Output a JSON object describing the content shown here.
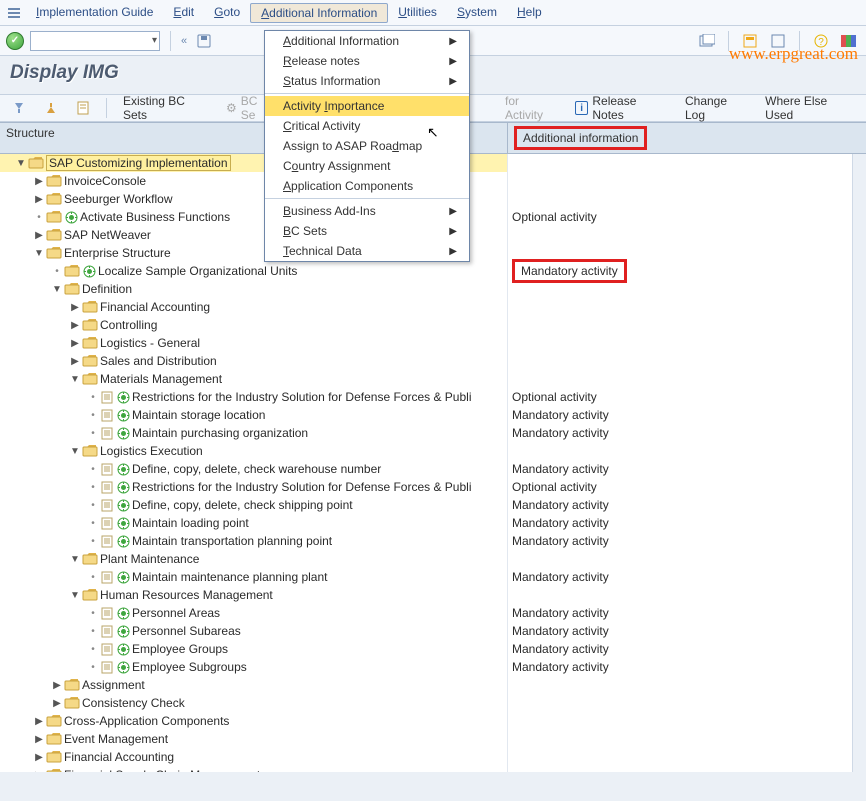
{
  "menubar": {
    "items": [
      {
        "label": "Implementation Guide",
        "u": "I"
      },
      {
        "label": "Edit",
        "u": "E"
      },
      {
        "label": "Goto",
        "u": "G"
      },
      {
        "label": "Additional Information",
        "u": "A",
        "selected": true
      },
      {
        "label": "Utilities",
        "u": "U"
      },
      {
        "label": "System",
        "u": "S"
      },
      {
        "label": "Help",
        "u": "H"
      }
    ]
  },
  "watermark": "www.erpgreat.com",
  "title": "Display IMG",
  "toolbar2": {
    "existing": "Existing BC Sets",
    "bcse": "BC Se",
    "foract": "for Activity",
    "release_notes": "Release Notes",
    "change_log": "Change Log",
    "where_else": "Where Else Used"
  },
  "header": {
    "col_struct": "Structure",
    "col_info": "Additional information"
  },
  "ctxmenu": {
    "items": [
      {
        "label": "Additional Information",
        "u": "A",
        "sub": true
      },
      {
        "label": "Release notes",
        "u": "R",
        "sub": true
      },
      {
        "label": "Status Information",
        "u": "S",
        "sub": true
      },
      {
        "sep": true
      },
      {
        "label": "Activity Importance",
        "u": "I",
        "hover": true
      },
      {
        "label": "Critical Activity",
        "u": "C"
      },
      {
        "label": "Assign to ASAP Roadmap",
        "u": "d"
      },
      {
        "label": "Country Assignment",
        "u": "o"
      },
      {
        "label": "Application Components",
        "u": "A"
      },
      {
        "sep": true
      },
      {
        "label": "Business Add-Ins",
        "u": "B",
        "sub": true
      },
      {
        "label": "BC Sets",
        "u": "B",
        "sub": true
      },
      {
        "label": "Technical Data",
        "u": "T",
        "sub": true
      }
    ]
  },
  "tree": [
    {
      "d": 0,
      "exp": "open",
      "folder": true,
      "text": "SAP Customizing Implementation",
      "hl": true,
      "sel": true,
      "info": ""
    },
    {
      "d": 1,
      "exp": "closed",
      "folder": true,
      "text": "InvoiceConsole",
      "info": ""
    },
    {
      "d": 1,
      "exp": "closed",
      "folder": true,
      "text": "Seeburger Workflow",
      "info": ""
    },
    {
      "d": 1,
      "exp": "leaf",
      "folder": true,
      "exec": true,
      "text": "Activate Business Functions",
      "info": "Optional activity"
    },
    {
      "d": 1,
      "exp": "closed",
      "folder": true,
      "text": "SAP NetWeaver",
      "info": ""
    },
    {
      "d": 1,
      "exp": "open",
      "folder": true,
      "text": "Enterprise Structure",
      "info": ""
    },
    {
      "d": 2,
      "exp": "leaf",
      "folder": true,
      "exec": true,
      "text": "Localize Sample Organizational Units",
      "info": "Mandatory activity",
      "info_red": true
    },
    {
      "d": 2,
      "exp": "open",
      "folder": true,
      "text": "Definition",
      "info": ""
    },
    {
      "d": 3,
      "exp": "closed",
      "folder": true,
      "text": "Financial Accounting",
      "info": ""
    },
    {
      "d": 3,
      "exp": "closed",
      "folder": true,
      "text": "Controlling",
      "info": ""
    },
    {
      "d": 3,
      "exp": "closed",
      "folder": true,
      "text": "Logistics - General",
      "info": ""
    },
    {
      "d": 3,
      "exp": "closed",
      "folder": true,
      "text": "Sales and Distribution",
      "info": ""
    },
    {
      "d": 3,
      "exp": "open",
      "folder": true,
      "text": "Materials Management",
      "info": ""
    },
    {
      "d": 4,
      "exp": "leaf",
      "note": true,
      "exec": true,
      "text": "Restrictions for the Industry Solution for Defense Forces & Publi",
      "info": "Optional activity"
    },
    {
      "d": 4,
      "exp": "leaf",
      "note": true,
      "exec": true,
      "text": "Maintain storage location",
      "info": "Mandatory activity"
    },
    {
      "d": 4,
      "exp": "leaf",
      "note": true,
      "exec": true,
      "text": "Maintain purchasing organization",
      "info": "Mandatory activity"
    },
    {
      "d": 3,
      "exp": "open",
      "folder": true,
      "text": "Logistics Execution",
      "info": ""
    },
    {
      "d": 4,
      "exp": "leaf",
      "note": true,
      "exec": true,
      "text": "Define, copy, delete, check warehouse number",
      "info": "Mandatory activity"
    },
    {
      "d": 4,
      "exp": "leaf",
      "note": true,
      "exec": true,
      "text": "Restrictions for the Industry Solution for Defense Forces & Publi",
      "info": "Optional activity"
    },
    {
      "d": 4,
      "exp": "leaf",
      "note": true,
      "exec": true,
      "text": "Define, copy, delete, check shipping point",
      "info": "Mandatory activity"
    },
    {
      "d": 4,
      "exp": "leaf",
      "note": true,
      "exec": true,
      "text": "Maintain loading point",
      "info": "Mandatory activity"
    },
    {
      "d": 4,
      "exp": "leaf",
      "note": true,
      "exec": true,
      "text": "Maintain transportation planning point",
      "info": "Mandatory activity"
    },
    {
      "d": 3,
      "exp": "open",
      "folder": true,
      "text": "Plant Maintenance",
      "info": ""
    },
    {
      "d": 4,
      "exp": "leaf",
      "note": true,
      "exec": true,
      "text": "Maintain maintenance planning plant",
      "info": "Mandatory activity"
    },
    {
      "d": 3,
      "exp": "open",
      "folder": true,
      "text": "Human Resources Management",
      "info": ""
    },
    {
      "d": 4,
      "exp": "leaf",
      "note": true,
      "exec": true,
      "text": "Personnel Areas",
      "info": "Mandatory activity"
    },
    {
      "d": 4,
      "exp": "leaf",
      "note": true,
      "exec": true,
      "text": "Personnel Subareas",
      "info": "Mandatory activity"
    },
    {
      "d": 4,
      "exp": "leaf",
      "note": true,
      "exec": true,
      "text": "Employee Groups",
      "info": "Mandatory activity"
    },
    {
      "d": 4,
      "exp": "leaf",
      "note": true,
      "exec": true,
      "text": "Employee Subgroups",
      "info": "Mandatory activity"
    },
    {
      "d": 2,
      "exp": "closed",
      "folder": true,
      "text": "Assignment",
      "info": ""
    },
    {
      "d": 2,
      "exp": "closed",
      "folder": true,
      "text": "Consistency Check",
      "info": ""
    },
    {
      "d": 1,
      "exp": "closed",
      "folder": true,
      "text": "Cross-Application Components",
      "info": ""
    },
    {
      "d": 1,
      "exp": "closed",
      "folder": true,
      "text": "Event Management",
      "info": ""
    },
    {
      "d": 1,
      "exp": "closed",
      "folder": true,
      "text": "Financial Accounting",
      "info": ""
    },
    {
      "d": 1,
      "exp": "closed",
      "folder": true,
      "text": "Financial Supply Chain Management",
      "info": ""
    }
  ]
}
